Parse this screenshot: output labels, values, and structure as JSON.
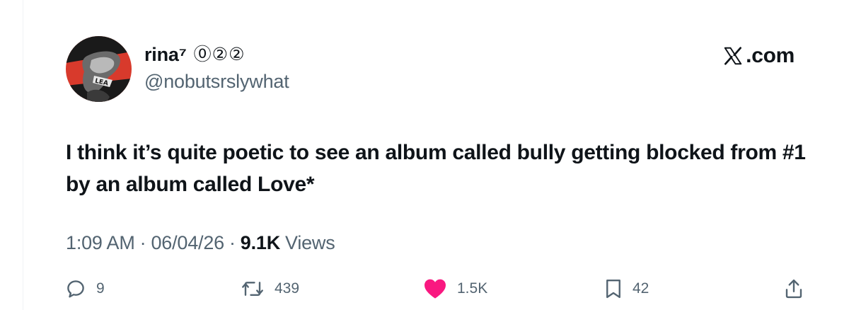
{
  "author": {
    "display_name": "rina⁷",
    "name_emblems": "⓪②②",
    "handle": "@nobutsrslywhat"
  },
  "brand": {
    "mark": "𝕏",
    "label": ".com"
  },
  "tweet": {
    "text": "I think it’s quite poetic to see an album called bully getting blocked from #1 by an album called Love*"
  },
  "meta": {
    "time": "1:09 AM",
    "separator": "·",
    "date": "06/04/26",
    "views_count": "9.1K",
    "views_label": "Views"
  },
  "actions": {
    "reply_count": "9",
    "repost_count": "439",
    "like_count": "1.5K",
    "bookmark_count": "42"
  },
  "icons": {
    "reply": "reply-icon",
    "repost": "repost-icon",
    "like": "heart-icon",
    "bookmark": "bookmark-icon",
    "share": "share-icon"
  },
  "colors": {
    "text_primary": "#0f1419",
    "text_secondary": "#536471",
    "like_pink": "#f91880",
    "avatar_red": "#d83a2c"
  }
}
